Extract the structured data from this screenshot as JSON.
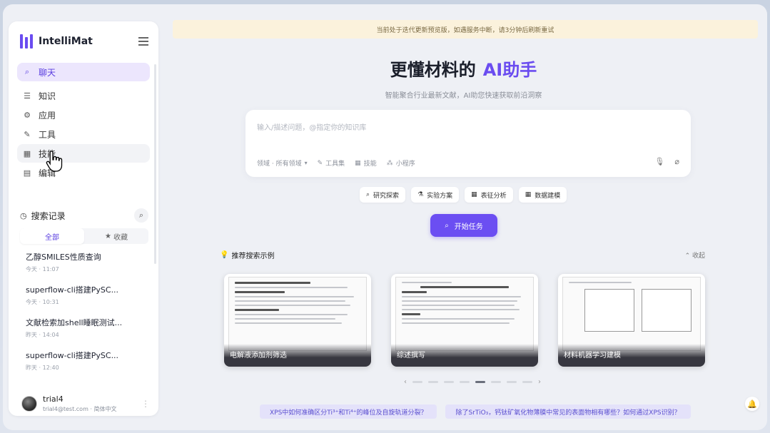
{
  "app": {
    "name": "IntelliMat"
  },
  "banner": {
    "text": "当前处于迭代更新预览版，如遇服务中断，请3分钟后刷新重试"
  },
  "nav": {
    "items": [
      {
        "label": "聊天",
        "icon": "search-icon",
        "glyph": "⌕"
      },
      {
        "label": "知识",
        "icon": "database-icon",
        "glyph": "☰"
      },
      {
        "label": "应用",
        "icon": "apps-icon",
        "glyph": "⚙"
      },
      {
        "label": "工具",
        "icon": "wrench-icon",
        "glyph": "✎"
      },
      {
        "label": "技能",
        "icon": "grid-icon",
        "glyph": "▦"
      },
      {
        "label": "编辑",
        "icon": "edit-icon",
        "glyph": "▤"
      }
    ]
  },
  "history": {
    "title": "搜索记录",
    "tabs": [
      "全部",
      "收藏"
    ],
    "items": [
      {
        "title": "乙醇SMILES性质查询",
        "time": "今天 · 11:07"
      },
      {
        "title": "superflow-cli搭建PySC...",
        "time": "今天 · 10:31"
      },
      {
        "title": "文献检索加shell睡眠测试...",
        "time": "昨天 · 14:04"
      },
      {
        "title": "superflow-cli搭建PySC...",
        "time": "昨天 · 12:40"
      }
    ]
  },
  "user": {
    "name": "trial4",
    "email": "trial4@test.com · 简体中文"
  },
  "hero": {
    "title": "更懂材料的",
    "title_ai": "AI助手",
    "subtitle": "智能聚合行业最新文献，AI助您快速获取前沿洞察"
  },
  "input": {
    "placeholder": "输入/描述问题，@指定你的知识库",
    "tools": [
      "领域 · 所有领域",
      "工具集",
      "技能",
      "小程序"
    ]
  },
  "chips": [
    "研究探索",
    "实验方案",
    "表征分析",
    "数据建模"
  ],
  "start_button": "开始任务",
  "recommend": {
    "title": "推荐搜索示例",
    "collapse": "收起",
    "cards": [
      "电解液添加剂筛选",
      "综述撰写",
      "材料机器学习建模"
    ]
  },
  "suggestions": [
    "XPS中如何准确区分Ti³⁺和Ti⁴⁺的峰位及自旋轨道分裂？",
    "除了SrTiO₃，钙钛矿氧化物薄膜中常见的表面物相有哪些？如何通过XPS识别？"
  ],
  "colors": {
    "accent": "#6b4ef2",
    "banner_bg": "#fbf2dc",
    "active_nav_bg": "#ece6fd"
  }
}
